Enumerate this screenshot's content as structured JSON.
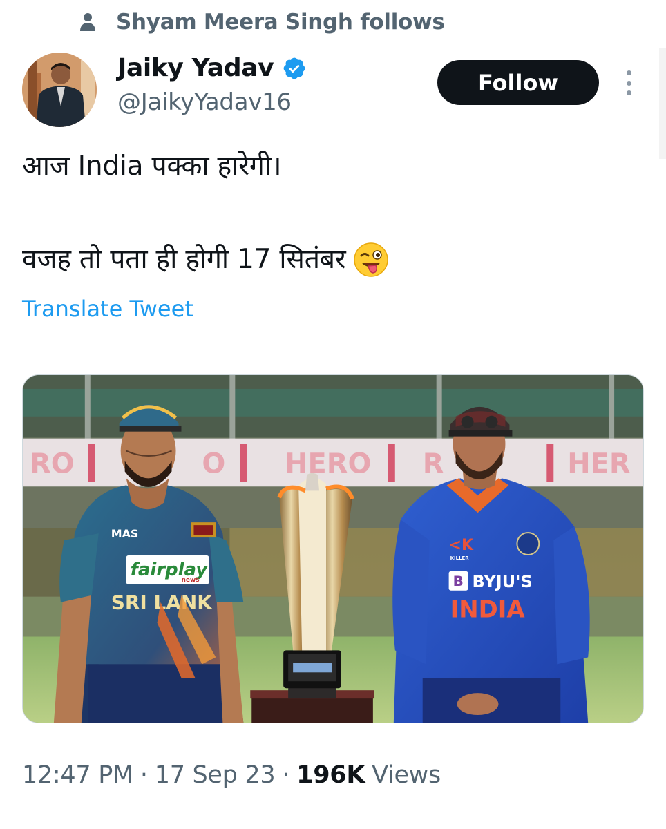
{
  "social_context": {
    "text": "Shyam Meera Singh follows",
    "icon": "person-icon"
  },
  "author": {
    "display_name": "Jaiky Yadav",
    "handle": "@JaikyYadav16",
    "verified": true,
    "verified_color": "#1d9bf0"
  },
  "follow_button": {
    "label": "Follow"
  },
  "tweet": {
    "line1": "आज India पक्का हारेगी।",
    "line2": "वजह तो पता ही होगी 17 सितंबर",
    "emoji": "winking-face-with-tongue"
  },
  "translate": {
    "label": "Translate Tweet"
  },
  "media": {
    "left_jersey_logo": "fairplay",
    "left_jersey_logo_sub": "news",
    "left_jersey_sponsor": "MAS",
    "left_jersey_text": "SRI LANK",
    "right_jersey_sponsor": "BYJU'S",
    "right_jersey_text": "INDIA",
    "right_jersey_brand": "KILLER",
    "board_text": "HERO"
  },
  "meta": {
    "time": "12:47 PM",
    "date": "17 Sep 23",
    "views_count": "196K",
    "views_label": "Views",
    "separator": "·"
  },
  "colors": {
    "text_primary": "#0f1419",
    "text_secondary": "#536471",
    "link": "#1d9bf0",
    "button_bg": "#0f1419"
  }
}
